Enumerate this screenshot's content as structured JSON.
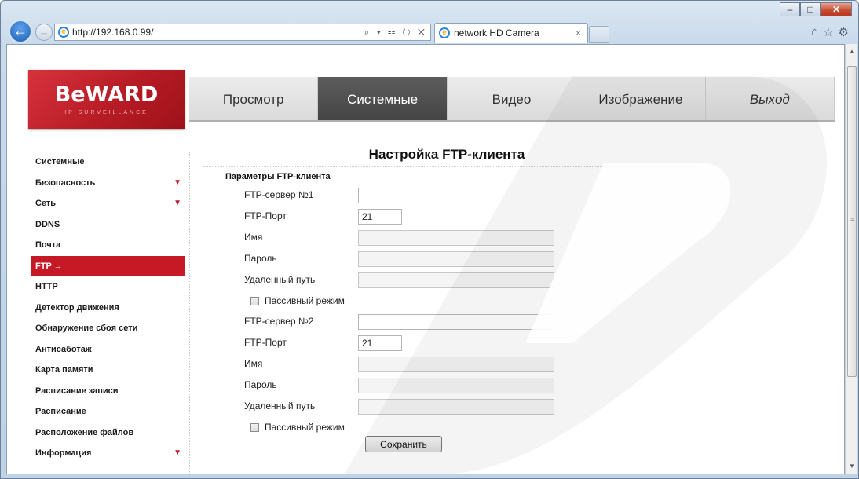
{
  "browser": {
    "url": "http://192.168.0.99/",
    "tab_title": "network HD Camera",
    "addr_tools": "⌕ ▾ ☷ ↻ ✕",
    "tab_close": "×",
    "window_buttons": {
      "minimize": "–",
      "maximize": "□",
      "close": "✕"
    },
    "chrome_icons": {
      "home": "⌂",
      "favorites": "☆",
      "tools": "⚙"
    },
    "icons": {
      "back": "arrow-left-icon",
      "forward": "arrow-right-icon",
      "site": "ie-icon"
    }
  },
  "logo": {
    "text": "BeWARD",
    "subtitle": "IP SURVEILLANCE"
  },
  "topnav": {
    "items": [
      {
        "label": "Просмотр"
      },
      {
        "label": "Системные"
      },
      {
        "label": "Видео"
      },
      {
        "label": "Изображение"
      },
      {
        "label": "Выход"
      }
    ],
    "active_index": 1
  },
  "sidebar": {
    "items": [
      {
        "label": "Системные",
        "expandable": false
      },
      {
        "label": "Безопасность",
        "expandable": true
      },
      {
        "label": "Сеть",
        "expandable": true
      },
      {
        "label": "DDNS",
        "expandable": false
      },
      {
        "label": "Почта",
        "expandable": false
      },
      {
        "label": "FTP →",
        "expandable": false
      },
      {
        "label": "HTTP",
        "expandable": false
      },
      {
        "label": "Детектор движения",
        "expandable": false
      },
      {
        "label": "Обнаружение сбоя сети",
        "expandable": false
      },
      {
        "label": "Антисаботаж",
        "expandable": false
      },
      {
        "label": "Карта памяти",
        "expandable": false
      },
      {
        "label": "Расписание записи",
        "expandable": false
      },
      {
        "label": "Расписание",
        "expandable": false
      },
      {
        "label": "Расположение файлов",
        "expandable": false
      },
      {
        "label": "Информация",
        "expandable": true
      }
    ],
    "active_index": 5,
    "accent_color": "#c51a26"
  },
  "main": {
    "title": "Настройка FTP-клиента",
    "section": "Параметры FTP-клиента",
    "server1": {
      "server_label": "FTP-сервер №1",
      "server_value": "",
      "port_label": "FTP-Порт",
      "port_value": "21",
      "name_label": "Имя",
      "name_value": "",
      "password_label": "Пароль",
      "password_value": "",
      "path_label": "Удаленный путь",
      "path_value": "",
      "passive_label": "Пассивный режим"
    },
    "server2": {
      "server_label": "FTP-сервер №2",
      "server_value": "",
      "port_label": "FTP-Порт",
      "port_value": "21",
      "name_label": "Имя",
      "name_value": "",
      "password_label": "Пароль",
      "password_value": "",
      "path_label": "Удаленный путь",
      "path_value": "",
      "passive_label": "Пассивный режим"
    },
    "save_label": "Сохранить"
  }
}
